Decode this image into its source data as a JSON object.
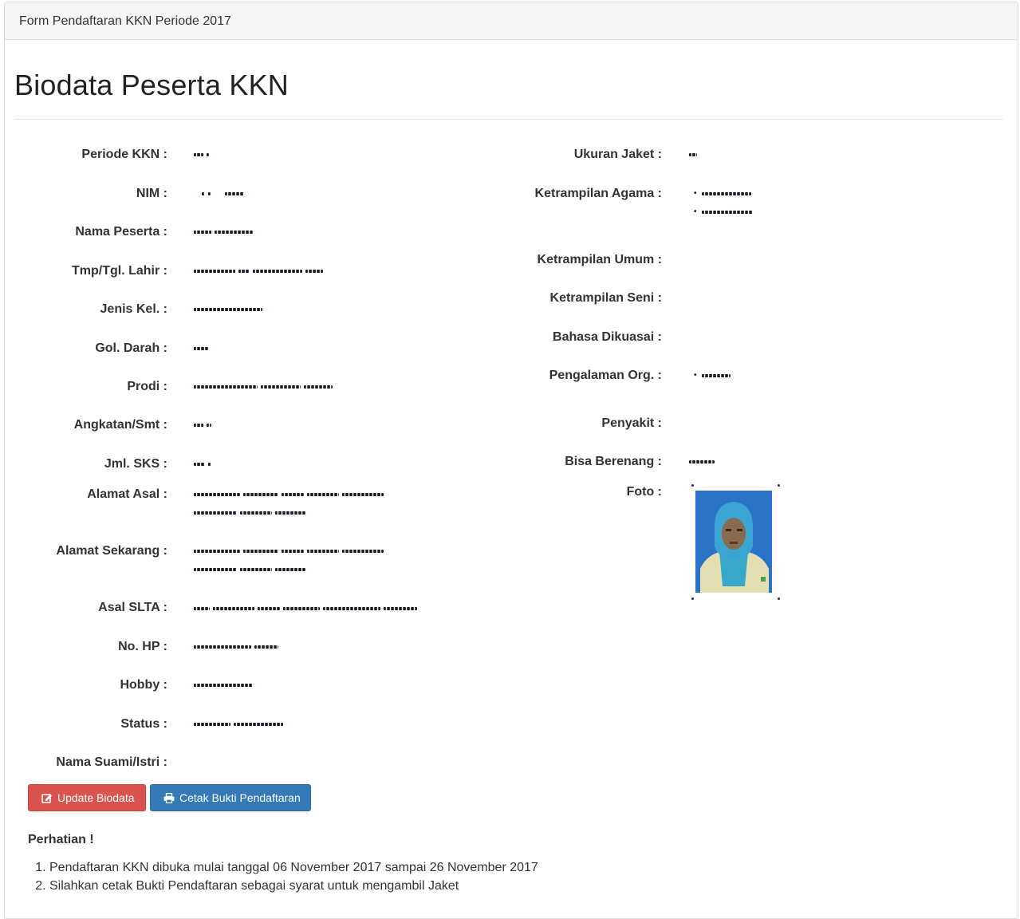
{
  "panel": {
    "heading": "Form Pendaftaran KKN Periode 2017"
  },
  "page": {
    "title": "Biodata Peserta KKN"
  },
  "left_fields": [
    {
      "label": "Periode KKN :",
      "value": "2017"
    },
    {
      "label": "NIM :",
      "value": ""
    },
    {
      "label": "Nama Peserta :",
      "value": ""
    },
    {
      "label": "Tmp/Tgl. Lahir :",
      "value": ""
    },
    {
      "label": "Jenis Kel. :",
      "value": ""
    },
    {
      "label": "Gol. Darah :",
      "value": ""
    },
    {
      "label": "Prodi :",
      "value": ""
    },
    {
      "label": "Angkatan/Smt :",
      "value": ""
    },
    {
      "label": "Jml. SKS :",
      "value": ""
    },
    {
      "label": "Alamat Asal :",
      "value": ""
    },
    {
      "label": "Alamat Sekarang :",
      "value": ""
    },
    {
      "label": "Asal SLTA :",
      "value": ""
    },
    {
      "label": "No. HP :",
      "value": ""
    },
    {
      "label": "Hobby :",
      "value": ""
    },
    {
      "label": "Status :",
      "value": ""
    },
    {
      "label": "Nama Suami/Istri :",
      "value": ""
    }
  ],
  "right_fields": [
    {
      "label": "Ukuran Jaket :",
      "value": ""
    },
    {
      "label": "Ketrampilan Agama :",
      "value": ""
    },
    {
      "label": "Ketrampilan Umum :",
      "value": ""
    },
    {
      "label": "Ketrampilan Seni :",
      "value": ""
    },
    {
      "label": "Bahasa Dikuasai :",
      "value": ""
    },
    {
      "label": "Pengalaman Org. :",
      "value": ""
    },
    {
      "label": "Penyakit :",
      "value": ""
    },
    {
      "label": "Bisa Berenang :",
      "value": ""
    },
    {
      "label": "Foto :",
      "value": ""
    }
  ],
  "buttons": {
    "update_label": "Update Biodata",
    "print_label": "Cetak Bukti Pendaftaran"
  },
  "notice": {
    "title": "Perhatian !",
    "items": [
      "Pendaftaran KKN dibuka mulai tanggal 06 November 2017 sampai 26 November 2017",
      "Silahkan cetak Bukti Pendaftaran sebagai syarat untuk mengambil Jaket"
    ]
  },
  "colors": {
    "danger": "#d9534f",
    "primary": "#337ab7",
    "heading_bg": "#f5f5f5"
  },
  "icons": {
    "update": "edit-icon",
    "print": "printer-icon"
  }
}
